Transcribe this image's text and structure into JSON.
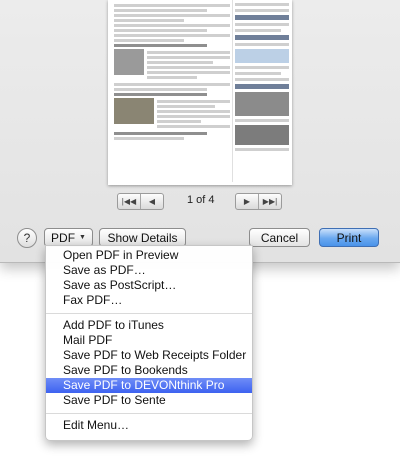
{
  "pager": {
    "page_label": "1 of 4",
    "first_icon": "first-page-icon",
    "prev_icon": "previous-page-icon",
    "next_icon": "next-page-icon",
    "last_icon": "last-page-icon"
  },
  "buttons": {
    "help_label": "?",
    "pdf_label": "PDF",
    "pdf_icon": "chevron-down-icon",
    "show_details_label": "Show Details",
    "cancel_label": "Cancel",
    "print_label": "Print"
  },
  "pdf_menu": {
    "groups": [
      [
        "Open PDF in Preview",
        "Save as PDF…",
        "Save as PostScript…",
        "Fax PDF…"
      ],
      [
        "Add PDF to iTunes",
        "Mail PDF",
        "Save PDF to Web Receipts Folder",
        "Save PDF to Bookends",
        "Save PDF to DEVONthink Pro",
        "Save PDF to Sente"
      ],
      [
        "Edit Menu…"
      ]
    ],
    "selected": "Save PDF to DEVONthink Pro"
  },
  "colors": {
    "selection": "#3d62f0",
    "primary_button": "#4a93ea"
  }
}
